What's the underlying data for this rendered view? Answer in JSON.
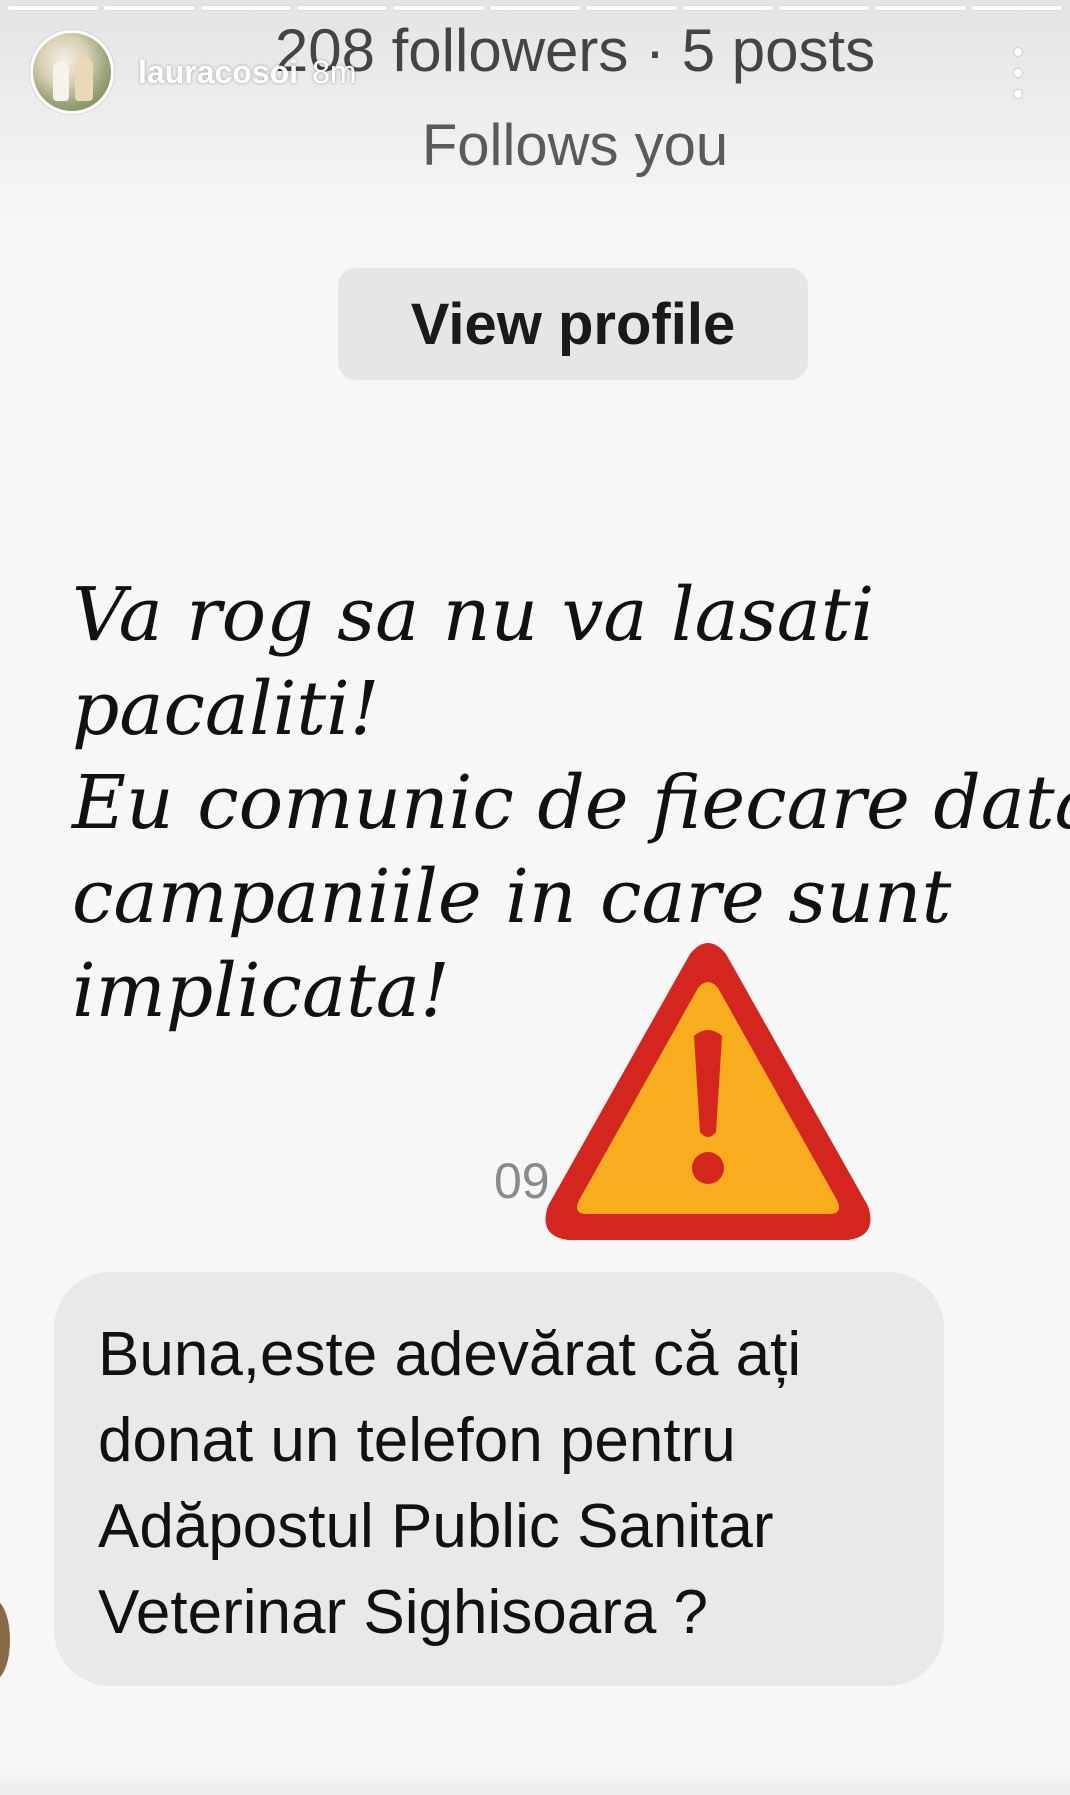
{
  "story": {
    "progress_segments": 11,
    "username": "lauracosoi",
    "time_ago": "8m",
    "more_icon": "vertical-ellipsis-icon"
  },
  "profile_card": {
    "followers_line": "208 followers · 5 posts",
    "follows_you": "Follows you",
    "view_profile_label": "View profile"
  },
  "story_text": {
    "lines": [
      "Va rog sa nu va lasati",
      "pacaliti!",
      "Eu comunic de fiecare data",
      "campaniile in care sunt",
      "implicata!"
    ]
  },
  "chat": {
    "timestamp_fragment": "09",
    "message_lines": [
      "Buna,este adevărat că ați",
      "donat un telefon pentru",
      "Adăpostul Public Sanitar",
      "Veterinar Sighisoara ?"
    ]
  },
  "sticker": {
    "icon": "warning-triangle-icon",
    "colors": {
      "fill": "#f8ad1e",
      "border": "#d5251f",
      "mark": "#d5251f"
    }
  }
}
